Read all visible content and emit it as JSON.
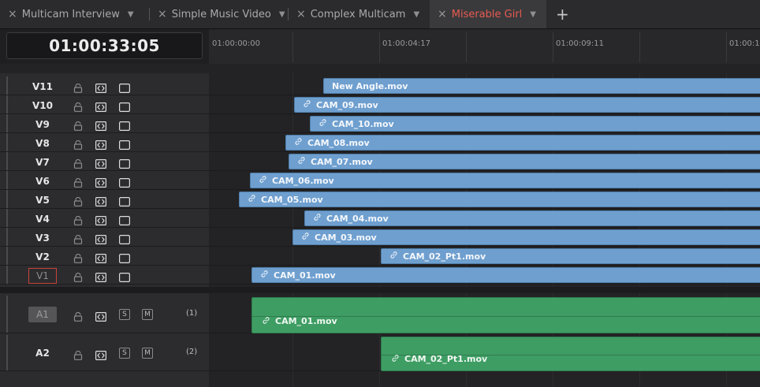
{
  "tabs": [
    {
      "label": "Multicam Interview",
      "active": false
    },
    {
      "label": "Simple Music Video",
      "active": false
    },
    {
      "label": "Complex Multicam",
      "active": false
    },
    {
      "label": "Miserable Girl",
      "active": true
    }
  ],
  "tab_close_glyph": "×",
  "tab_menu_glyph": "⌄",
  "add_tab_glyph": "+",
  "timecode": "01:00:33:05",
  "ruler": [
    "01:00:00:00",
    "01:00:04:17",
    "01:00:09:11",
    "01:00:1"
  ],
  "video_tracks": [
    {
      "name": "V11",
      "clip": "New Angle.mov",
      "linked": false
    },
    {
      "name": "V10",
      "clip": "CAM_09.mov",
      "linked": true
    },
    {
      "name": "V9",
      "clip": "CAM_10.mov",
      "linked": true
    },
    {
      "name": "V8",
      "clip": "CAM_08.mov",
      "linked": true
    },
    {
      "name": "V7",
      "clip": "CAM_07.mov",
      "linked": true
    },
    {
      "name": "V6",
      "clip": "CAM_06.mov",
      "linked": true
    },
    {
      "name": "V5",
      "clip": "CAM_05.mov",
      "linked": true
    },
    {
      "name": "V4",
      "clip": "CAM_04.mov",
      "linked": true
    },
    {
      "name": "V3",
      "clip": "CAM_03.mov",
      "linked": true
    },
    {
      "name": "V2",
      "clip": "CAM_02_Pt1.mov",
      "linked": true
    },
    {
      "name": "V1",
      "clip": "CAM_01.mov",
      "linked": true
    }
  ],
  "audio_tracks": [
    {
      "name": "A1",
      "solo": "S",
      "mute": "M",
      "channels": "(1)",
      "clip": "CAM_01.mov"
    },
    {
      "name": "A2",
      "solo": "S",
      "mute": "M",
      "channels": "(2)",
      "clip": "CAM_02_Pt1.mov"
    }
  ],
  "link_glyph": "🔗",
  "colors": {
    "video_clip": "#6e9fcf",
    "audio_clip": "#3e9d63",
    "active_tab_text": "#e65b50",
    "v1_outline": "#c9443a"
  },
  "icons": [
    "close-icon",
    "chevron-down-icon",
    "plus-icon",
    "lock-icon",
    "auto-select-icon",
    "monitor-icon",
    "link-icon"
  ]
}
